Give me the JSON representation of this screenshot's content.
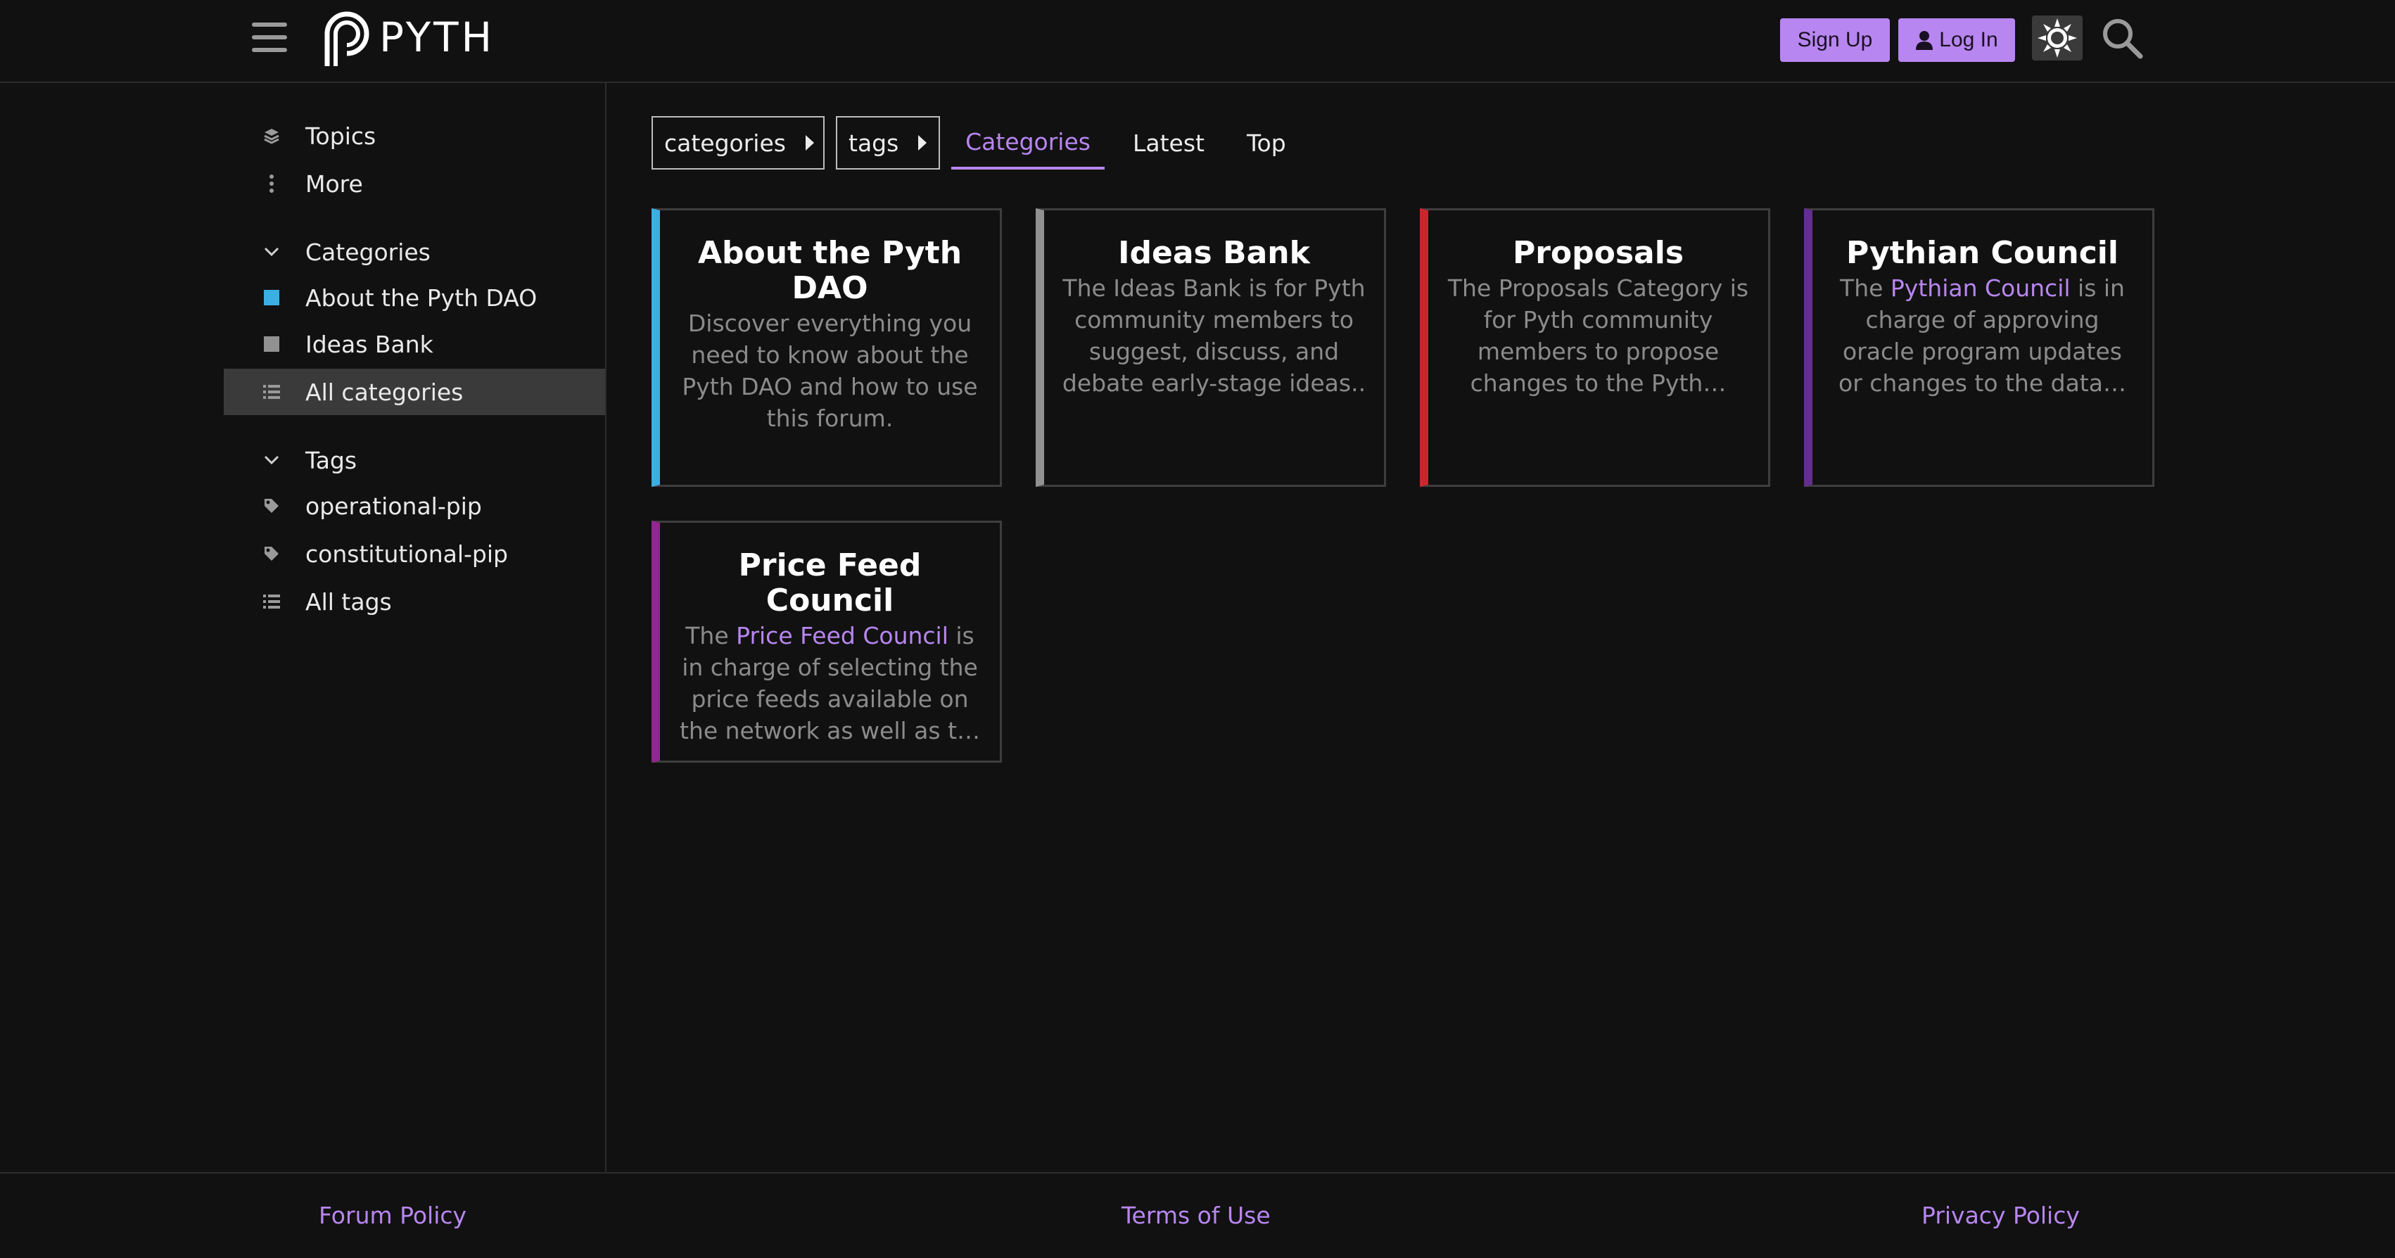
{
  "header": {
    "logo_text": "PYTH",
    "signup_label": "Sign Up",
    "login_label": "Log In",
    "accent_color": "#b886f0"
  },
  "sidebar": {
    "top_items": [
      {
        "label": "Topics",
        "icon": "layers-icon"
      },
      {
        "label": "More",
        "icon": "vertical-ellipsis-icon"
      }
    ],
    "categories_heading": "Categories",
    "categories": [
      {
        "label": "About the Pyth DAO",
        "color": "#3ab0e2"
      },
      {
        "label": "Ideas Bank",
        "color": "#919191"
      },
      {
        "label": "All categories",
        "icon": "list-icon",
        "active": true
      }
    ],
    "tags_heading": "Tags",
    "tags": [
      {
        "label": "operational-pip",
        "icon": "tag-icon"
      },
      {
        "label": "constitutional-pip",
        "icon": "tag-icon"
      },
      {
        "label": "All tags",
        "icon": "list-icon"
      }
    ]
  },
  "nav": {
    "categories_dropdown": "categories",
    "tags_dropdown": "tags",
    "tabs": [
      "Categories",
      "Latest",
      "Top"
    ],
    "active_tab": "Categories"
  },
  "cards": [
    {
      "title": "About the Pyth DAO",
      "desc": "Discover everything you need to know about the Pyth DAO and how to use this forum.",
      "color": "#3ab0e2"
    },
    {
      "title": "Ideas Bank",
      "desc": "The Ideas Bank is for Pyth community members to suggest, discuss, and debate early-stage ideas..",
      "color": "#919191"
    },
    {
      "title": "Proposals",
      "desc": "The Proposals Category is for Pyth community members to propose changes to the Pyth…",
      "color": "#c9272e"
    },
    {
      "title": "Pythian Council",
      "desc_pre": "The ",
      "desc_link": "Pythian Council",
      "desc_post": " is in charge of approving oracle program updates or changes to the data…",
      "color": "#652d90"
    },
    {
      "title": "Price Feed Council",
      "desc_pre": "The ",
      "desc_link": "Price Feed Council",
      "desc_post": " is in charge of selecting the price feeds available on the network as well as t…",
      "color": "#92278f"
    }
  ],
  "footer": {
    "links": [
      "Forum Policy",
      "Terms of Use",
      "Privacy Policy"
    ]
  }
}
